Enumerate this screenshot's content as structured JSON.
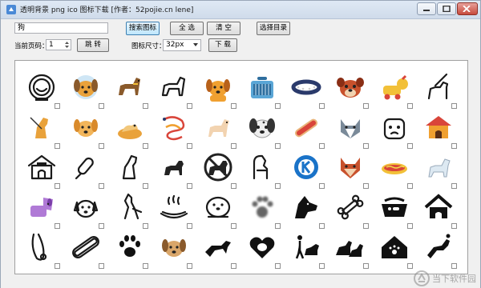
{
  "window": {
    "title": "透明背景 png ico 图标下载 [作者：52pojie.cn lene]"
  },
  "toolbar": {
    "search_value": "狗",
    "search_button": "搜索图标",
    "select_all_button": "全 选",
    "clear_button": "清 空",
    "choose_dir_button": "选择目录",
    "current_page_label": "当前页码：",
    "page_value": "1",
    "jump_button": "跳 转",
    "icon_size_label": "图标尺寸：",
    "icon_size_value": "32px",
    "download_button": "下 载"
  },
  "icons": [
    [
      "astronaut-dog-icon",
      "space-dog-icon",
      "walking-dog-icon",
      "dog-outline-icon",
      "puppy-icon",
      "pet-carrier-icon",
      "dog-collar-icon",
      "dog-face-icon",
      "toy-dog-icon",
      "dog-leash-icon"
    ],
    [
      "sitting-dog-icon",
      "golden-dog-icon",
      "dog-bed-icon",
      "tangled-leash-icon",
      "shiba-dog-icon",
      "dalmatian-face-icon",
      "hotdog-icon",
      "husky-face-icon",
      "bulldog-face-icon",
      "dog-house-icon"
    ],
    [
      "kennel-icon",
      "corn-dog-icon",
      "dog-sitting-outline-icon",
      "dog-silhouette-icon",
      "no-dogs-icon",
      "dog-chair-icon",
      "kodi-k-icon",
      "fox-dog-face-icon",
      "sausage-icon",
      "white-dog-icon"
    ],
    [
      "purple-dog-icon",
      "dog-head-icon",
      "kangaroo-icon",
      "hotdog-steam-icon",
      "seal-icon",
      "blur-paw-icon",
      "dog-head-silhouette-icon",
      "dog-bone-icon",
      "dog-bowl-icon",
      "dog-house-outline-icon"
    ],
    [
      "leash-icon",
      "hotdog-outline-icon",
      "paw-print-icon",
      "cute-puppy-icon",
      "running-dog-icon",
      "dog-heart-icon",
      "dog-walker-icon",
      "dogs-pair-icon",
      "house-paw-icon",
      "jumping-dog-icon"
    ]
  ],
  "watermark": {
    "text": "当下软件园"
  },
  "colors": {
    "accent": "#3c7fb1",
    "orange": "#f0a030",
    "red": "#d9453a",
    "blue": "#1a73c8"
  }
}
